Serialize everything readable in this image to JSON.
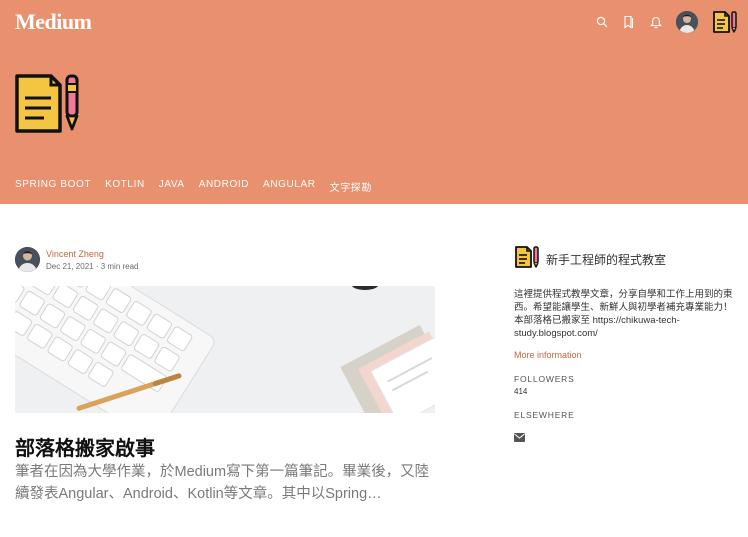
{
  "app": {
    "logo_text": "Medium"
  },
  "nav": {
    "items": [
      "SPRING BOOT",
      "KOTLIN",
      "JAVA",
      "ANDROID",
      "ANGULAR",
      "文字探勘"
    ]
  },
  "post": {
    "author": "Vincent Zheng",
    "meta": "Dec 21, 2021 · 3 min read",
    "title": "部落格搬家啟事",
    "excerpt": "筆者在因為大學作業，於Medium寫下第一篇筆記。畢業後，又陸續發表Angular、Android、Kotlin等文章。其中以Spring…"
  },
  "sidebar": {
    "publication_name": "新手工程師的程式教室",
    "description": "這裡提供程式教學文章，分享自學和工作上用到的東西。希望能讓學生、新鮮人與初學者補充專業能力！本部落格已搬家至 https://chikuwa-tech-study.blogspot.com/",
    "more_info": "More information",
    "followers_label": "Followers",
    "followers_count": "414",
    "elsewhere_label": "Elsewhere"
  },
  "colors": {
    "header_bg": "#e9906f",
    "accent": "#c4673f",
    "icon_yellow": "#f4c542"
  },
  "icons": [
    "search-icon",
    "bookmark-icon",
    "bell-icon",
    "avatar",
    "publication-logo-icon",
    "mail-icon"
  ]
}
